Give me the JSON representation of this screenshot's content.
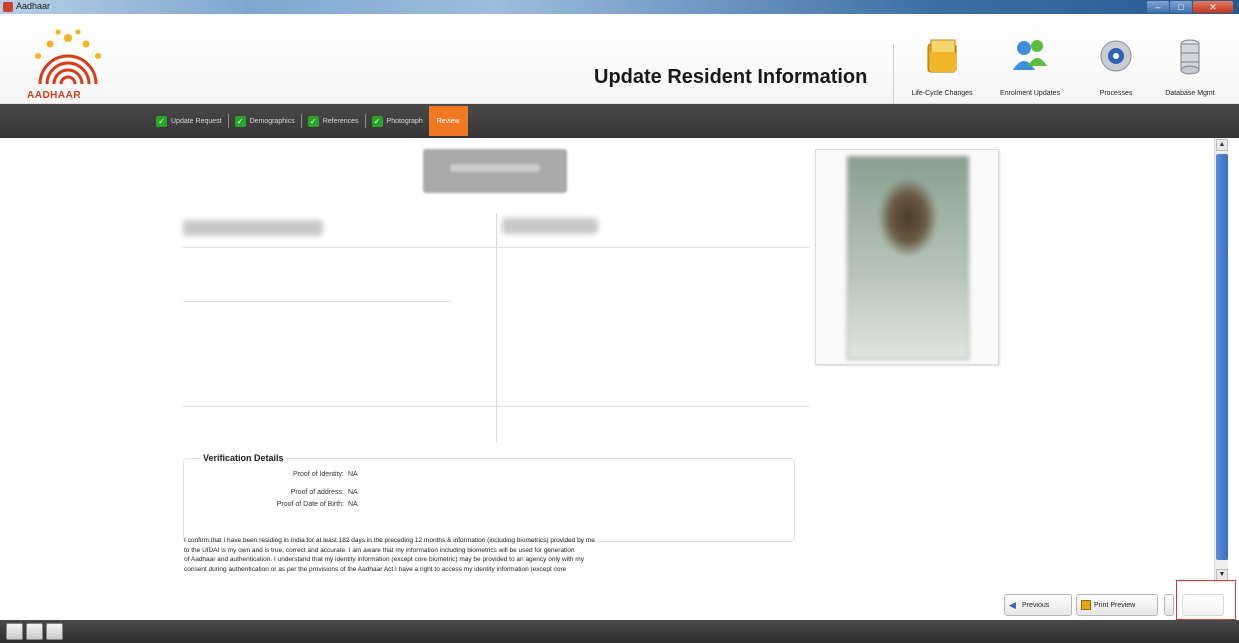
{
  "window": {
    "title": "Aadhaar"
  },
  "header": {
    "logo_text": "AADHAAR",
    "title": "Update Resident Information",
    "tools": [
      {
        "label": "Life-Cycle Changes",
        "icon": "folder-icon"
      },
      {
        "label": "Enrolment Updates",
        "icon": "users-icon"
      },
      {
        "label": "Processes",
        "icon": "gear-icon"
      },
      {
        "label": "Database Mgmt",
        "icon": "database-icon"
      }
    ]
  },
  "steps": [
    {
      "label": "Update Request",
      "done": true
    },
    {
      "label": "Demographics",
      "done": true
    },
    {
      "label": "References",
      "done": true
    },
    {
      "label": "Photograph",
      "done": true
    },
    {
      "label": "Review",
      "done": false,
      "active": true
    }
  ],
  "verification": {
    "title": "Verification Details",
    "rows": [
      {
        "label": "Proof of Identity:",
        "value": "NA"
      },
      {
        "label": "Proof of address:",
        "value": "NA"
      },
      {
        "label": "Proof of Date of Birth:",
        "value": "NA"
      }
    ]
  },
  "consent_lines": [
    "I confirm that I have been residing in India for at least 182 days in the preceding 12 months & information (including biometrics) provided by me",
    "to the UIDAI is my own and is true, correct and accurate. I am aware that my information including biometrics will be used for generation",
    "of Aadhaar and authentication. I understand that my identity information (except core biometric) may be provided to an agency only with my",
    "consent during authentication or as per the provisions of the Aadhaar Act.I have a right to access my identity information (except core"
  ],
  "buttons": {
    "previous": "Previous",
    "print_preview": "Print Preview"
  },
  "colors": {
    "active_step": "#f07822",
    "step_check": "#2aa52a",
    "scroll_thumb": "#3a6ec2",
    "highlight": "#d9372a"
  }
}
